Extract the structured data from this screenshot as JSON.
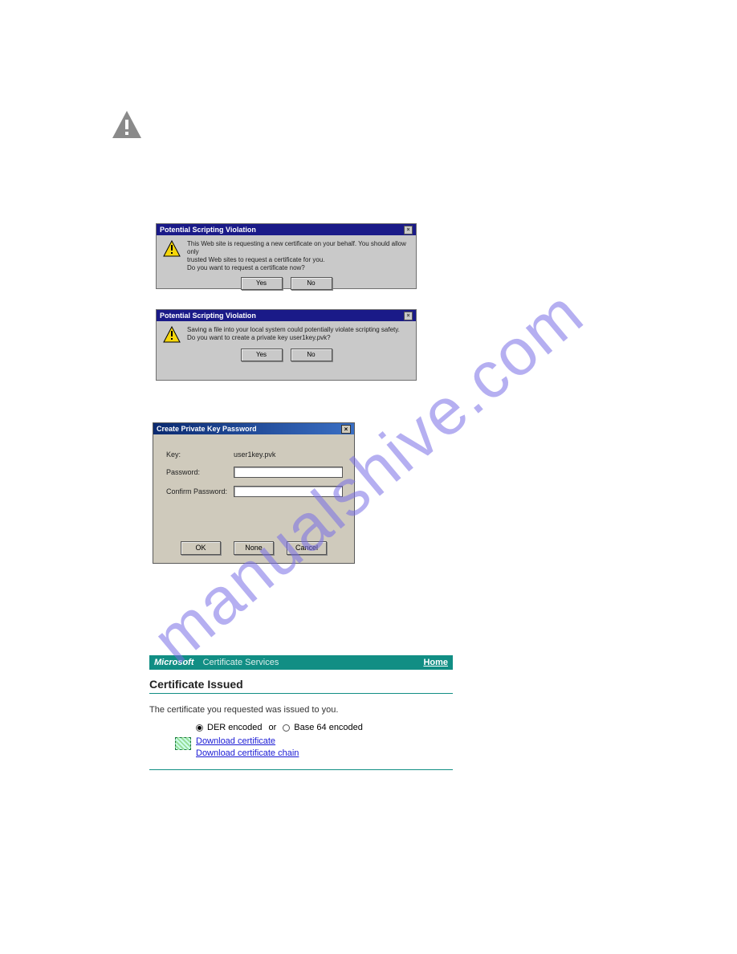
{
  "watermark": "manualshive.com",
  "psv_title": "Potential Scripting Violation",
  "dialog1": {
    "line1": "This Web site is requesting a new certificate on your behalf. You should allow only",
    "line2": "trusted Web sites to request a certificate for you.",
    "line3": "Do you want to request a certificate now?",
    "yes": "Yes",
    "no": "No"
  },
  "dialog2": {
    "line1": "Saving a file into your local system could potentially violate scripting safety.",
    "line2": "Do you want to create a private key user1key.pvk?",
    "yes": "Yes",
    "no": "No"
  },
  "pkp": {
    "title": "Create Private Key Password",
    "key_label": "Key:",
    "key_value": "user1key.pvk",
    "pass_label": "Password:",
    "confirm_label": "Confirm Password:",
    "ok": "OK",
    "none": "None",
    "cancel": "Cancel"
  },
  "cert": {
    "brand": "Microsoft",
    "service": "Certificate Services",
    "home": "Home",
    "heading": "Certificate Issued",
    "issued_text": "The certificate you requested was issued to you.",
    "der_label": "DER encoded",
    "or_label": "or",
    "b64_label": "Base 64 encoded",
    "dl_cert": "Download certificate",
    "dl_chain": "Download certificate chain"
  }
}
